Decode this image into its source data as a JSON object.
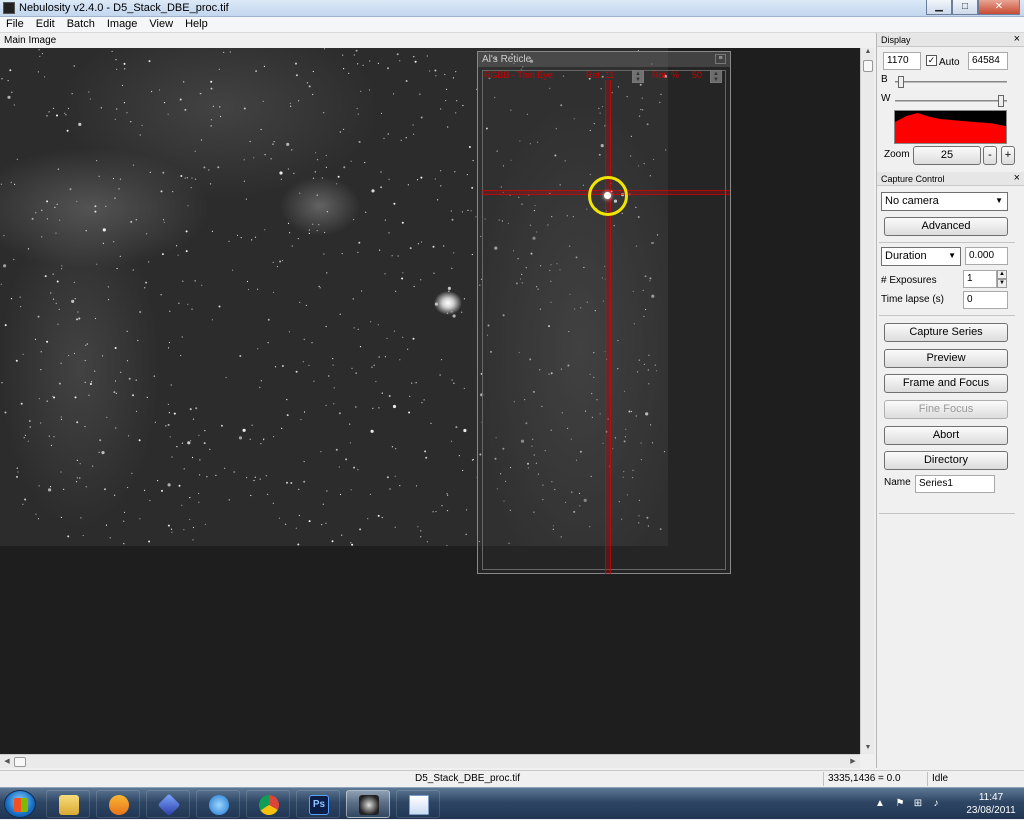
{
  "window": {
    "title": "Nebulosity v2.4.0 - D5_Stack_DBE_proc.tif",
    "buttons": {
      "minimize": "▁",
      "maximize": "□",
      "close": "✕"
    }
  },
  "menu": [
    "File",
    "Edit",
    "Batch",
    "Image",
    "View",
    "Help"
  ],
  "main_image": {
    "caption": "Main Image"
  },
  "reticle": {
    "title": "Al's Reticle",
    "info": [
      "RGBB - Thin Eye",
      "Ret. 11",
      "Rot. %",
      "50"
    ]
  },
  "display": {
    "title": "Display",
    "black_value": "1170",
    "auto_label": "Auto",
    "auto_checked": true,
    "white_value": "64584",
    "b_label": "B",
    "w_label": "W",
    "b_slider_fraction": 0.03,
    "w_slider_fraction": 0.97,
    "zoom_label": "Zoom",
    "zoom_value": "25",
    "zoom_minus": "-",
    "zoom_plus": "+",
    "histogram_color": "#ff0000"
  },
  "capture": {
    "title": "Capture Control",
    "camera": "No camera",
    "advanced": "Advanced",
    "duration_mode": "Duration",
    "duration_value": "0.000",
    "exposures_label": "# Exposures",
    "exposures_value": "1",
    "timelapse_label": "Time lapse (s)",
    "timelapse_value": "0",
    "buttons": {
      "capture_series": "Capture Series",
      "preview": "Preview",
      "frame_focus": "Frame and Focus",
      "fine_focus": "Fine Focus",
      "abort": "Abort",
      "directory": "Directory"
    },
    "name_label": "Name",
    "name_value": "Series1"
  },
  "status": {
    "filename": "D5_Stack_DBE_proc.tif",
    "coords": "3335,1436 = 0.0",
    "state": "Idle"
  },
  "taskbar": {
    "apps": [
      "explorer",
      "media-player",
      "app-cube",
      "internet-explorer",
      "chrome",
      "photoshop",
      "nebulosity",
      "window"
    ],
    "photoshop_label": "Ps",
    "time": "11:47",
    "date": "23/08/2011"
  },
  "colors": {
    "accent_ring": "#f2e600",
    "reticle": "#cc0000"
  }
}
